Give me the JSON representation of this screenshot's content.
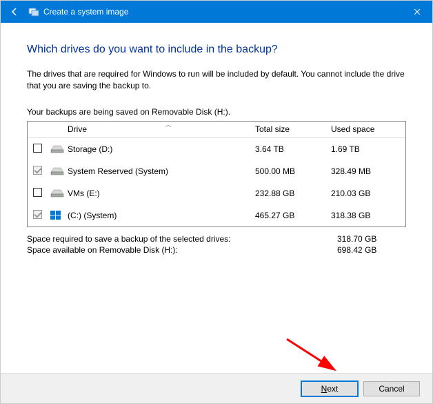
{
  "titlebar": {
    "title": "Create a system image"
  },
  "heading": "Which drives do you want to include in the backup?",
  "description": "The drives that are required for Windows to run will be included by default. You cannot include the drive that you are saving the backup to.",
  "subLabel": "Your backups are being saved on Removable Disk (H:).",
  "columns": {
    "drive": "Drive",
    "totalSize": "Total size",
    "usedSpace": "Used space"
  },
  "drives": [
    {
      "checked": false,
      "disabled": false,
      "iconType": "hdd",
      "name": "Storage (D:)",
      "totalSize": "3.64 TB",
      "usedSpace": "1.69 TB"
    },
    {
      "checked": true,
      "disabled": true,
      "iconType": "hdd",
      "name": "System Reserved (System)",
      "totalSize": "500.00 MB",
      "usedSpace": "328.49 MB"
    },
    {
      "checked": false,
      "disabled": false,
      "iconType": "hdd",
      "name": "VMs (E:)",
      "totalSize": "232.88 GB",
      "usedSpace": "210.03 GB"
    },
    {
      "checked": true,
      "disabled": true,
      "iconType": "win",
      "name": "(C:) (System)",
      "totalSize": "465.27 GB",
      "usedSpace": "318.38 GB"
    }
  ],
  "summary": {
    "requiredLabel": "Space required to save a backup of the selected drives:",
    "requiredValue": "318.70 GB",
    "availableLabel": "Space available on Removable Disk (H:):",
    "availableValue": "698.42 GB"
  },
  "buttons": {
    "next": "Next",
    "cancel": "Cancel"
  }
}
